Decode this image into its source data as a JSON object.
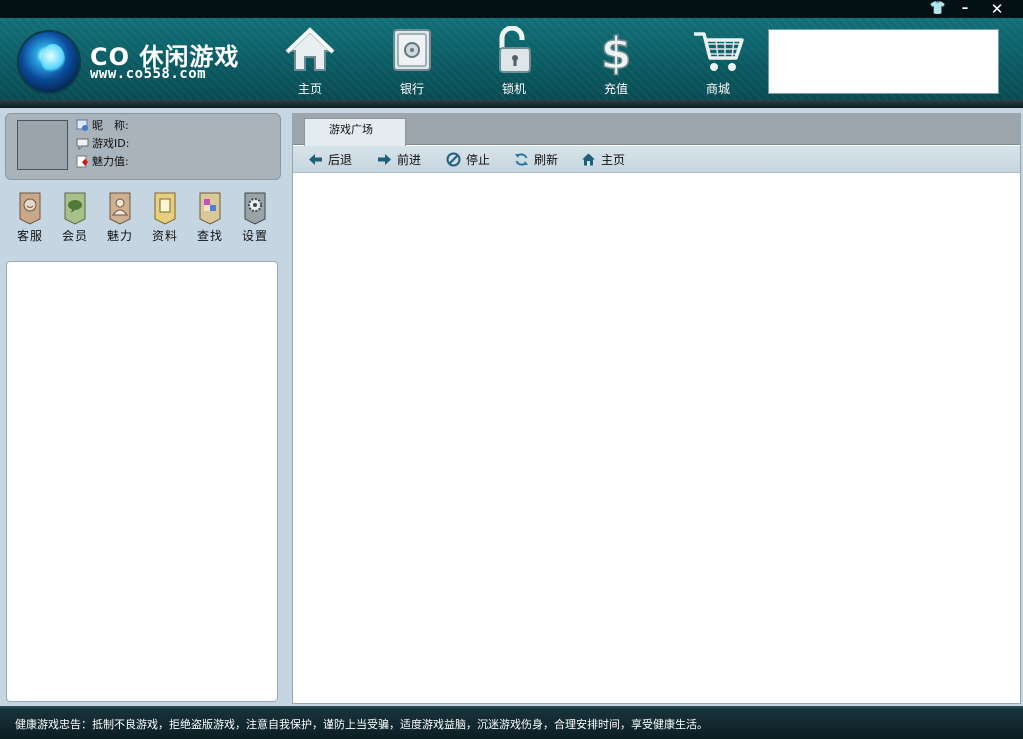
{
  "window": {
    "skin_glyph": "👕",
    "minimize_glyph": "–",
    "close_glyph": "✕"
  },
  "brand": {
    "title": "CO 休闲游戏",
    "url": "www.co558.com"
  },
  "nav": [
    {
      "label": "主页",
      "icon": "home-icon"
    },
    {
      "label": "银行",
      "icon": "safe-icon"
    },
    {
      "label": "锁机",
      "icon": "padlock-icon"
    },
    {
      "label": "充值",
      "icon": "dollar-icon"
    },
    {
      "label": "商城",
      "icon": "shopping-cart-icon"
    }
  ],
  "user": {
    "nickname_label": "昵　称:",
    "game_id_label": "游戏ID:",
    "charm_label": "魅力值:"
  },
  "functions": [
    {
      "label": "客服",
      "icon": "support-icon"
    },
    {
      "label": "会员",
      "icon": "member-icon"
    },
    {
      "label": "魅力",
      "icon": "charm-icon"
    },
    {
      "label": "资料",
      "icon": "profile-icon"
    },
    {
      "label": "查找",
      "icon": "search-icon"
    },
    {
      "label": "设置",
      "icon": "settings-icon"
    }
  ],
  "browser": {
    "tab_label": "游戏广场",
    "toolbar": {
      "back": "后退",
      "forward": "前进",
      "stop": "停止",
      "refresh": "刷新",
      "home": "主页"
    }
  },
  "status": {
    "notice": "健康游戏忠告：抵制不良游戏，拒绝盗版游戏，注意自我保护，谨防上当受骗，适度游戏益脑，沉迷游戏伤身，合理安排时间，享受健康生活。"
  },
  "colors": {
    "header": "#0b5a62",
    "panel": "#c5d6e2",
    "status_bar": "#0b1e24"
  }
}
